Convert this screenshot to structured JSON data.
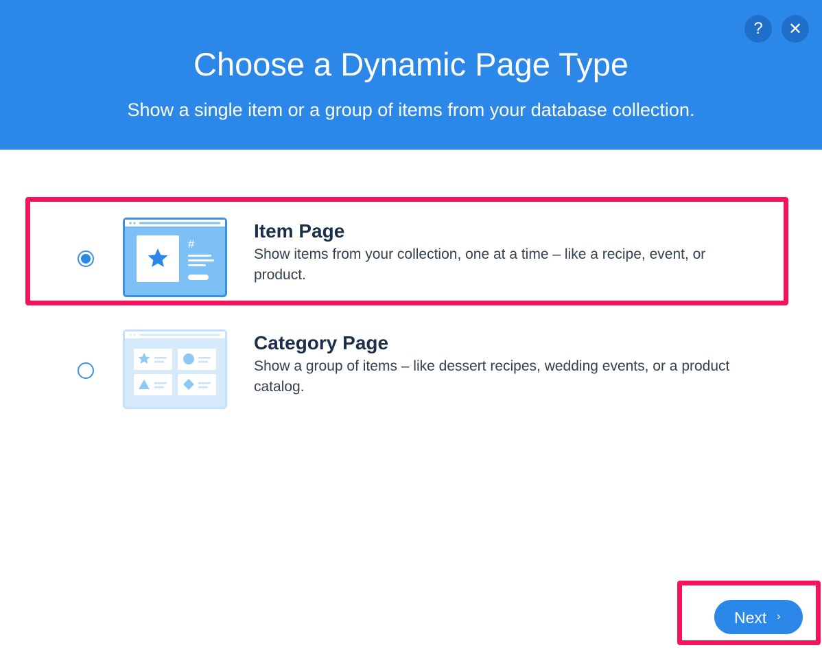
{
  "header": {
    "title": "Choose a Dynamic Page Type",
    "subtitle": "Show a single item or a group of items from your database collection.",
    "help_glyph": "?",
    "close_glyph": "✕"
  },
  "options": [
    {
      "title": "Item Page",
      "description": "Show items from your collection, one at a time – like a recipe, event, or product.",
      "selected": true,
      "icon": "item-page-thumbnail-icon"
    },
    {
      "title": "Category Page",
      "description": "Show a group of items – like dessert recipes, wedding events, or a product catalog.",
      "selected": false,
      "icon": "category-page-thumbnail-icon"
    }
  ],
  "footer": {
    "next_label": "Next",
    "next_chevron": "›"
  },
  "colors": {
    "header_bg": "#2b87e8",
    "accent": "#2b87e8",
    "highlight": "#f5135b",
    "text_dark": "#1b2f4a"
  }
}
